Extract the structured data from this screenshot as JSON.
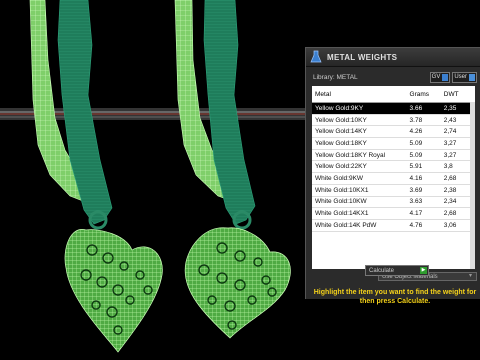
{
  "panel": {
    "title": "METAL WEIGHTS",
    "library_label": "Library: METAL",
    "toggle_gv": "GV",
    "toggle_user": "User",
    "columns": [
      "Metal",
      "Grams",
      "DWT"
    ],
    "rows": [
      {
        "metal": "Yellow Gold:9KY",
        "grams": "3.66",
        "dwt": "2,35"
      },
      {
        "metal": "Yellow Gold:10KY",
        "grams": "3.78",
        "dwt": "2,43"
      },
      {
        "metal": "Yellow Gold:14KY",
        "grams": "4.26",
        "dwt": "2,74"
      },
      {
        "metal": "Yellow Gold:18KY",
        "grams": "5.09",
        "dwt": "3,27"
      },
      {
        "metal": "Yellow Gold:18KY Royal",
        "grams": "5.09",
        "dwt": "3,27"
      },
      {
        "metal": "Yellow Gold:22KY",
        "grams": "5.91",
        "dwt": "3,8"
      },
      {
        "metal": "White Gold:9KW",
        "grams": "4.16",
        "dwt": "2,68"
      },
      {
        "metal": "White Gold:10KX1",
        "grams": "3.69",
        "dwt": "2,38"
      },
      {
        "metal": "White Gold:10KW",
        "grams": "3.63",
        "dwt": "2,34"
      },
      {
        "metal": "White Gold:14KX1",
        "grams": "4.17",
        "dwt": "2,68"
      },
      {
        "metal": "White Gold:14K PdW",
        "grams": "4.76",
        "dwt": "3,06"
      }
    ],
    "selected_row": 0,
    "use_object_materials": "Use Object Materials",
    "hint": "Highlight the item you want to find the weight for then press Calculate.",
    "calculate_label": "Calculate"
  },
  "colors": {
    "mesh": "#8ee07a",
    "stem": "#1d7a5a",
    "hint_text": "#f5d21a",
    "selected_row_bg": "#000000"
  }
}
